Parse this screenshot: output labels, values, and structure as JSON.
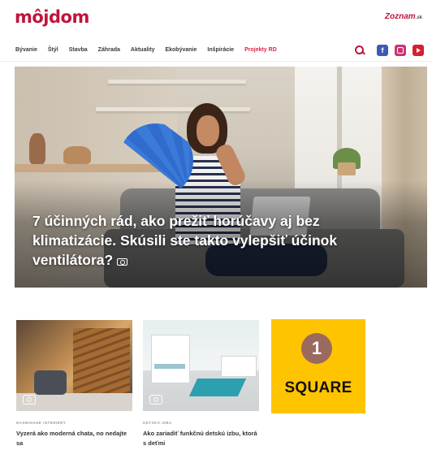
{
  "header": {
    "logo": "môjdom",
    "partner": "Zoznam",
    "partner_suffix": ".sk"
  },
  "nav": {
    "items": [
      {
        "label": "Bývanie",
        "promo": false
      },
      {
        "label": "Štýl",
        "promo": false
      },
      {
        "label": "Stavba",
        "promo": false
      },
      {
        "label": "Záhrada",
        "promo": false
      },
      {
        "label": "Aktuality",
        "promo": false
      },
      {
        "label": "Ekobývanie",
        "promo": false
      },
      {
        "label": "Inšpirácie",
        "promo": false
      },
      {
        "label": "Projekty RD",
        "promo": true
      }
    ],
    "icons": [
      "search-icon",
      "facebook-icon",
      "instagram-icon",
      "youtube-icon"
    ]
  },
  "hero": {
    "title": "7 účinných rád, ako prežiť horúčavy aj bez klimatizácie. Skúsili ste takto vylepšiť účinok ventilátora?",
    "icon": "camera-icon"
  },
  "cards": [
    {
      "category": "NASBIHANÉ INTERIÉRY",
      "sub": "",
      "title": "Vyzerá ako moderná chata, no nedajte sa",
      "icon": "camera-icon"
    },
    {
      "category": "DETSKÁ IZBA",
      "sub": "",
      "title": "Ako zariadiť funkčnú detskú izbu, ktorá s deťmi",
      "icon": "camera-icon"
    }
  ],
  "ad": {
    "number": "1",
    "label": "SQUARE",
    "background": "#ffc400",
    "badge_color": "#9b6a5f"
  },
  "colors": {
    "brand": "#c0143c",
    "promo": "#e0254a"
  }
}
